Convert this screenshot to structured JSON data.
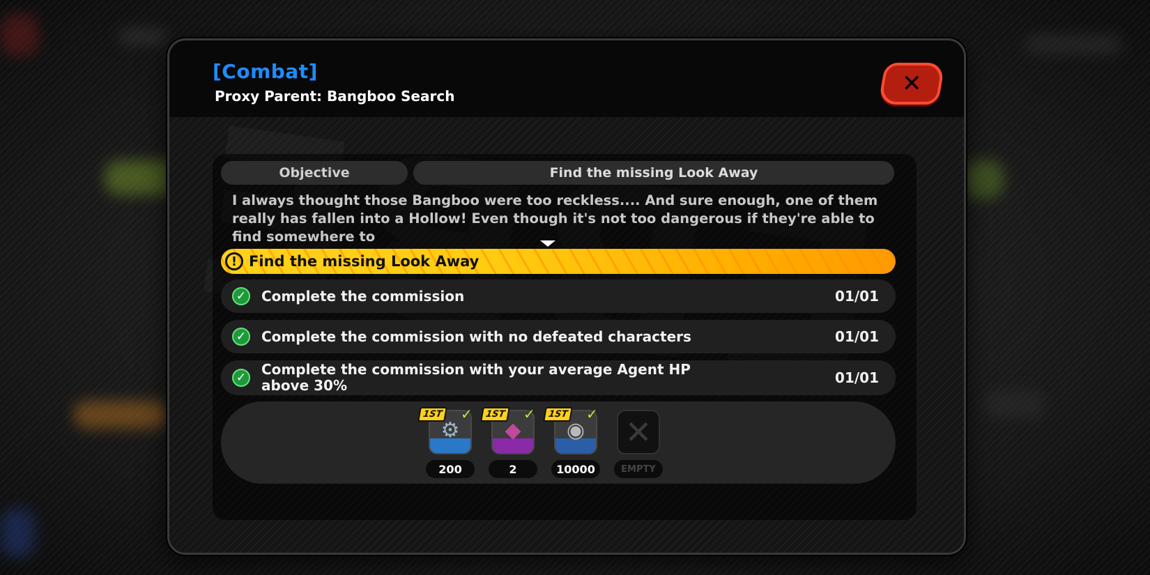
{
  "header": {
    "category": "[Combat]",
    "subtitle": "Proxy Parent: Bangboo Search"
  },
  "close_button": {
    "glyph": "✕",
    "icon": "close-icon"
  },
  "objective": {
    "label": "Objective",
    "title": "Find the missing Look Away",
    "description": "I always thought those Bangboo were too reckless.... And sure enough, one of them really has fallen into a Hollow! Even though it's not too dangerous if they're able to find somewhere to"
  },
  "quest": {
    "icon_glyph": "!",
    "text": "Find the missing Look Away"
  },
  "tasks": [
    {
      "label": "Complete the commission",
      "progress": "01/01",
      "done": true
    },
    {
      "label": "Complete the commission with no defeated characters",
      "progress": "01/01",
      "done": true
    },
    {
      "label": "Complete the commission with your average Agent HP above 30%",
      "progress": "01/01",
      "done": true
    }
  ],
  "rewards": [
    {
      "badge": "1ST",
      "claimed": true,
      "quantity": "200",
      "icon": "gear-chip-icon",
      "glyph": "⚙",
      "base_color": "#2a78c8"
    },
    {
      "badge": "1ST",
      "claimed": true,
      "quantity": "2",
      "icon": "purple-material-icon",
      "glyph": "◆",
      "base_color": "#8a2aa8"
    },
    {
      "badge": "1ST",
      "claimed": true,
      "quantity": "10000",
      "icon": "denny-coin-icon",
      "glyph": "◉",
      "base_color": "#2a5fa8"
    },
    {
      "badge": "",
      "claimed": false,
      "quantity": "EMPTY",
      "icon": "empty-slot-icon",
      "glyph": "✕",
      "base_color": "#111111"
    }
  ],
  "check_glyph": "✓",
  "colors": {
    "accent_blue": "#1e8cff",
    "close_red": "#b31e0f",
    "banner_yellow": "#ffcc12",
    "check_green": "#1f9a3a"
  }
}
